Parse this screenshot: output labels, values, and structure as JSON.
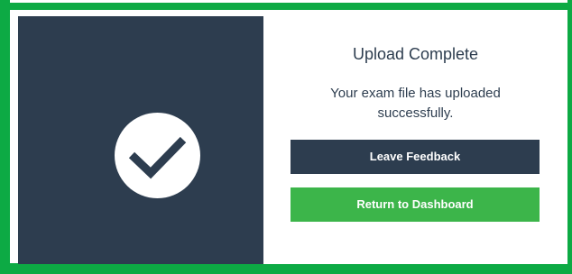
{
  "dialog": {
    "title": "Upload Complete",
    "message": "Your exam file has uploaded successfully.",
    "feedback_button_label": "Leave Feedback",
    "dashboard_button_label": "Return to Dashboard",
    "status_icon": "checkmark-icon"
  },
  "colors": {
    "frame_border": "#0daa44",
    "dark_panel": "#2d3d4f",
    "primary_button": "#2d3d4f",
    "success_button": "#3cb54a",
    "text": "#2d3d4f"
  }
}
